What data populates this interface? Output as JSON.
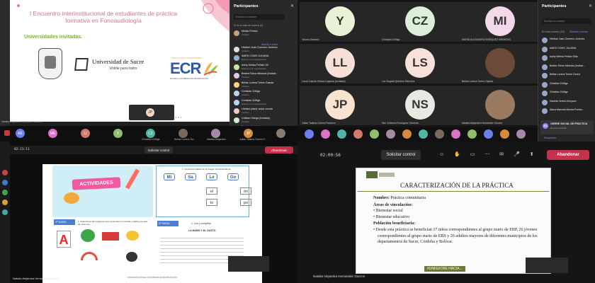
{
  "q1": {
    "slide_title": "I Encuentro interinstitucional de estudiantes de práctica formativa en Fonoaudiología",
    "subtitle": "Universidades invitadas.",
    "sucre_name": "Universidad de Sucre",
    "sucre_tagline": "Visible para todos",
    "ecr_tag": "INSTITUCIÓN UNIVERSITARIA",
    "ecr_logo": "ECR",
    "ecr_sub": "ESCUELA COLOMBIANA DE REHABILITACIÓN",
    "panel_title": "Participantes",
    "search_placeholder": "Escriba un nombre",
    "section_lobby": "Sí en la sala de espera (2)",
    "admit_all": "Admitir a todos",
    "participants": [
      {
        "name": "Melisa Peñalo",
        "role": "Invitado",
        "color": "#c9a27a"
      },
      {
        "name": "Heidlan Juan Guerrero Jiménez",
        "role": "Invitado",
        "color": "#e0dede"
      },
      {
        "name": "AMED COMO JULIANA",
        "role": "Externo a su organización",
        "color": "#8fb4d9"
      },
      {
        "name": "Ashly Melisa Peñalo Gil",
        "role": "Externo a su organización",
        "color": "#c7e6a3"
      },
      {
        "name": "Beatriz Elena Miranda (Invitad...",
        "role": "Invitado",
        "color": "#e3c5e8"
      },
      {
        "name": "Bellas Lorena Torres Gasnia",
        "role": "Invitado",
        "color": "#ffd27a"
      },
      {
        "name": "Christian Zúñiga",
        "role": "Invitado",
        "color": "#b9d4f2"
      },
      {
        "name": "Christian Zúñiga",
        "role": "Externo a su organización",
        "color": "#b9d4f2"
      },
      {
        "name": "Lisbiani (dani) verjar ucusla",
        "role": "Invitado",
        "color": "#f2c6c6"
      },
      {
        "name": "Cristian Ortega (Invitado)",
        "role": "Invitado",
        "color": "#cdeed6"
      },
      {
        "name": "Daniela Verbel Arroyave",
        "role": "Invitado",
        "color": "#ffe6a8"
      }
    ],
    "strip_label": "Natalia Alejandra Hernandez Garzon",
    "strip": [
      {
        "t": "AE",
        "c": "#6d7ff0",
        "n": ""
      },
      {
        "t": "ME",
        "c": "#d873c8",
        "n": ""
      },
      {
        "t": "LI",
        "c": "#d07b6e",
        "n": ""
      },
      {
        "t": "Y",
        "c": "#8fbf6a",
        "n": ""
      },
      {
        "t": "CZ",
        "c": "#4fb6a6",
        "n": "Christian Zúñiga"
      },
      {
        "t": "",
        "c": "#7a6a5e",
        "n": "Bellas Lorena Tor..."
      },
      {
        "t": "",
        "c": "#a58aa8",
        "n": "Natalia Alejandra..."
      },
      {
        "t": "JP",
        "c": "#d68c3c",
        "n": "Julian Tatiana Guerra P..."
      },
      {
        "t": "",
        "c": "#8a7b70",
        "n": ""
      }
    ],
    "corner_text": "3 0 4 5 4",
    "mini_label": "JP"
  },
  "q2": {
    "tiles": [
      {
        "i": "Y",
        "c": "#e9f1d6",
        "n": "Yesmo Jiménez"
      },
      {
        "i": "CZ",
        "c": "#dcefd8",
        "n": "Christian Zúñiga"
      },
      {
        "i": "MI",
        "c": "#f3d8e9",
        "n": "MARÍA ALEJANDRA ENRÍQUEZ INFANTAS"
      },
      {
        "i": "LL",
        "c": "#f5dfd6",
        "n": "Laura Camila Viesca Legarda (Invitado)"
      },
      {
        "i": "LS",
        "c": "#f6e2d9",
        "n": "Luz Ángela Quintero Sánchez"
      },
      {
        "i": "",
        "c": "#6b4a37",
        "n": "Bellas Lorena Torres Ospina"
      },
      {
        "i": "JP",
        "c": "#f7e3cf",
        "n": "Julian Tatiana Guerra Pacheco"
      },
      {
        "i": "NS",
        "c": "#e9e8e3",
        "n": "Nini Johanna Rodríguez Sánchez"
      },
      {
        "i": "",
        "c": "#9b7a62",
        "n": "Natalia Alejandra Hernández Garzón"
      }
    ],
    "panel_title": "Participantes",
    "search_placeholder": "Escriba un nombre",
    "section": "En esta reunión (19)",
    "mute_all": "Silenciar a todos",
    "people": [
      "Heidian Juan Guerrero Jiménez",
      "AMED COMO JULIANA",
      "Ashly Melisa Peñalo Gilia",
      "Beatriz Elena Miranda (Invitad...",
      "Bellas Lorena Torres Ozorio",
      "Christian Zúñiga",
      "Christian Zúñiga",
      "Daniela Verbel Arroyave",
      "Diana Marcela Murcia Pombo..."
    ],
    "chat_card": "CIERRE SOCIAL DE PRÁCTICA",
    "chat_sub": "Reunión iniciada",
    "chat_reply": "Responder"
  },
  "q3": {
    "timer": "02:21:11",
    "request_control": "Solicitar control",
    "stop_share": "Abandonar",
    "banner": "ACTIVIDADES",
    "card1_title": "1. Conecta la sílaba con la imagen correspondiente.",
    "syll_top": [
      "Mi",
      "Sa",
      "Le",
      "Go"
    ],
    "syll_mid": [
      "el",
      "ón",
      "to",
      "po"
    ],
    "level1": "1º NIVEL",
    "level1_text": "1. Seleccionar las imágenes que comienzan con la letra o sílaba que está de color rojo.",
    "level2": "2º NIVEL",
    "level2_text": "1. Lee y completa",
    "story_title": "LA MARIZ Y EL GUSTO",
    "letter": "A",
    "footer_brand": "FUNDACIÓN ESCUELA COLOMBIANA DE REHABILITACIÓN",
    "presenter": "Natalia Alejandra Hernandez Garzon"
  },
  "q4": {
    "timer": "02:00:56",
    "request_control": "Solicitar control",
    "stop_share": "Abandonar",
    "title": "CARACTERIZACIÓN DE LA PRÁCTICA",
    "name_lbl": "Nombre:",
    "name_val": "Práctica comunitaria",
    "areas_lbl": "Áreas de vinculación:",
    "areas": [
      "Bienestar social",
      "Bienestar educativo"
    ],
    "pop_lbl": "Población beneficiaria:",
    "pop_text": "Desde esta práctica se benefician 17 niños correspondientes al grupo etario de EBP, 26 jóvenes correspondientes al grupo etario de EBS y 20 adultos mayores de diferentes municipios de los departamentos de Sucre, Córdoba y Bolívar.",
    "footer_tag": "#UNISUCRE HACIA...",
    "presenter": "Natalia Alejandra Hernandez Garzon"
  }
}
